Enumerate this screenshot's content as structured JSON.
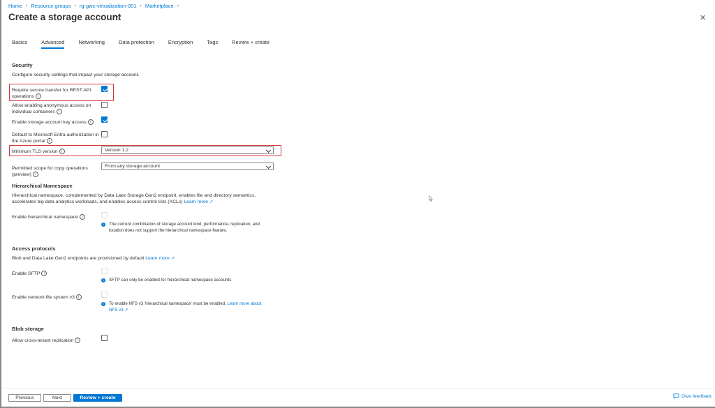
{
  "breadcrumb": [
    "Home",
    "Resource groups",
    "rg-gwc-virtualization-001",
    "Marketplace"
  ],
  "page": {
    "title": "Create a storage account",
    "ellipsis": "···",
    "close_icon": "close-icon"
  },
  "tabs": [
    {
      "label": "Basics",
      "active": false
    },
    {
      "label": "Advanced",
      "active": true
    },
    {
      "label": "Networking",
      "active": false
    },
    {
      "label": "Data protection",
      "active": false
    },
    {
      "label": "Encryption",
      "active": false
    },
    {
      "label": "Tags",
      "active": false
    },
    {
      "label": "Review + create",
      "active": false
    }
  ],
  "security": {
    "heading": "Security",
    "description": "Configure security settings that impact your storage account.",
    "secure_transfer": {
      "label": "Require secure transfer for REST API operations",
      "checked": true
    },
    "anonymous_access": {
      "label": "Allow enabling anonymous access on individual containers",
      "checked": false
    },
    "key_access": {
      "label": "Enable storage account key access",
      "checked": true
    },
    "entra_default": {
      "label": "Default to Microsoft Entra authorization in the Azure portal",
      "checked": false
    },
    "tls": {
      "label": "Minimum TLS version",
      "value": "Version 1.2"
    },
    "copy_scope": {
      "label": "Permitted scope for copy operations (preview)",
      "value": "From any storage account"
    }
  },
  "hns": {
    "heading": "Hierarchical Namespace",
    "description": "Hierarchical namespace, complemented by Data Lake Storage Gen2 endpoint, enables file and directory semantics, accelerates big data analytics workloads, and enables access control lists (ACLs)",
    "learn_more": "Learn more",
    "enable_label": "Enable hierarchical namespace",
    "info": "The current combination of storage account kind, performance, replication, and location does not support the hierarchical namespace feature."
  },
  "access": {
    "heading": "Access protocols",
    "description": "Blob and Data Lake Gen2 endpoints are provisioned by default",
    "learn_more": "Learn more",
    "sftp_label": "Enable SFTP",
    "sftp_info": "SFTP can only be enabled for hierarchical namespace accounts",
    "nfs_label": "Enable network file system v3",
    "nfs_info": "To enable NFS v3 'hierarchical namespace' must be enabled.",
    "nfs_learn_more": "Learn more about NFS v3"
  },
  "blob": {
    "heading": "Blob storage",
    "cross_tenant_label": "Allow cross-tenant replication",
    "cross_tenant_checked": false
  },
  "footer": {
    "previous": "Previous",
    "next": "Next",
    "review_create": "Review + create",
    "feedback": "Give feedback"
  },
  "colors": {
    "accent": "#0078d4",
    "highlight": "#d13438"
  }
}
